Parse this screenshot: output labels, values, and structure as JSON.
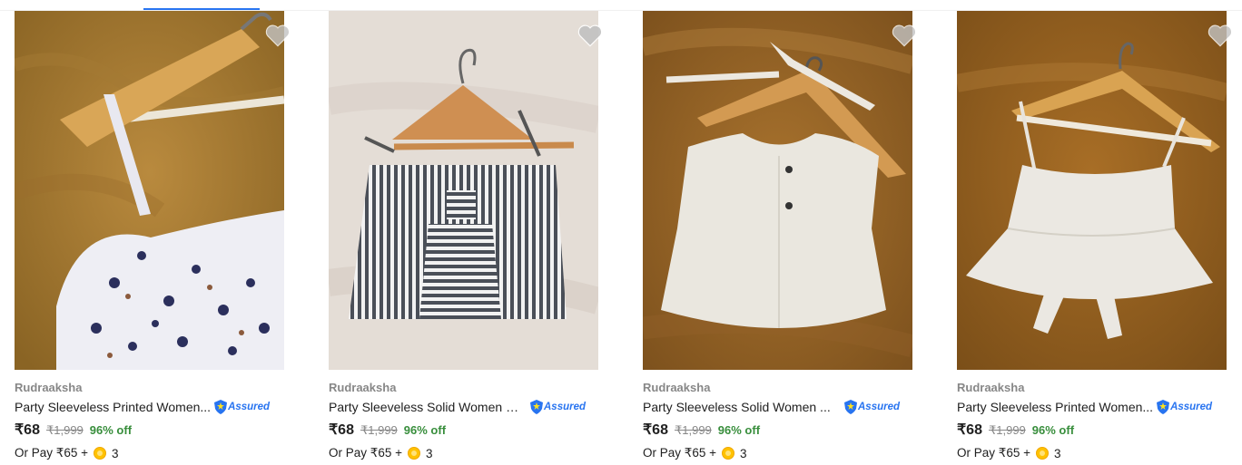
{
  "products": [
    {
      "brand": "Rudraaksha",
      "title": "Party Sleeveless Printed Women...",
      "assured": "Assured",
      "price": "₹68",
      "mrp": "₹1,999",
      "discount": "96% off",
      "pay_prefix": "Or Pay ₹65 +",
      "coins": "3",
      "icon": "heart-icon"
    },
    {
      "brand": "Rudraaksha",
      "title": "Party Sleeveless Solid Women Bl...",
      "assured": "Assured",
      "price": "₹68",
      "mrp": "₹1,999",
      "discount": "96% off",
      "pay_prefix": "Or Pay ₹65 +",
      "coins": "3",
      "icon": "heart-icon"
    },
    {
      "brand": "Rudraaksha",
      "title": "Party Sleeveless Solid Women ...",
      "assured": "Assured",
      "price": "₹68",
      "mrp": "₹1,999",
      "discount": "96% off",
      "pay_prefix": "Or Pay ₹65 +",
      "coins": "3",
      "icon": "heart-icon"
    },
    {
      "brand": "Rudraaksha",
      "title": "Party Sleeveless Printed Women...",
      "assured": "Assured",
      "price": "₹68",
      "mrp": "₹1,999",
      "discount": "96% off",
      "pay_prefix": "Or Pay ₹65 +",
      "coins": "3",
      "icon": "heart-icon"
    }
  ],
  "colors": {
    "accent": "#2874f0",
    "discount": "#388e3c",
    "muted": "#878787"
  }
}
